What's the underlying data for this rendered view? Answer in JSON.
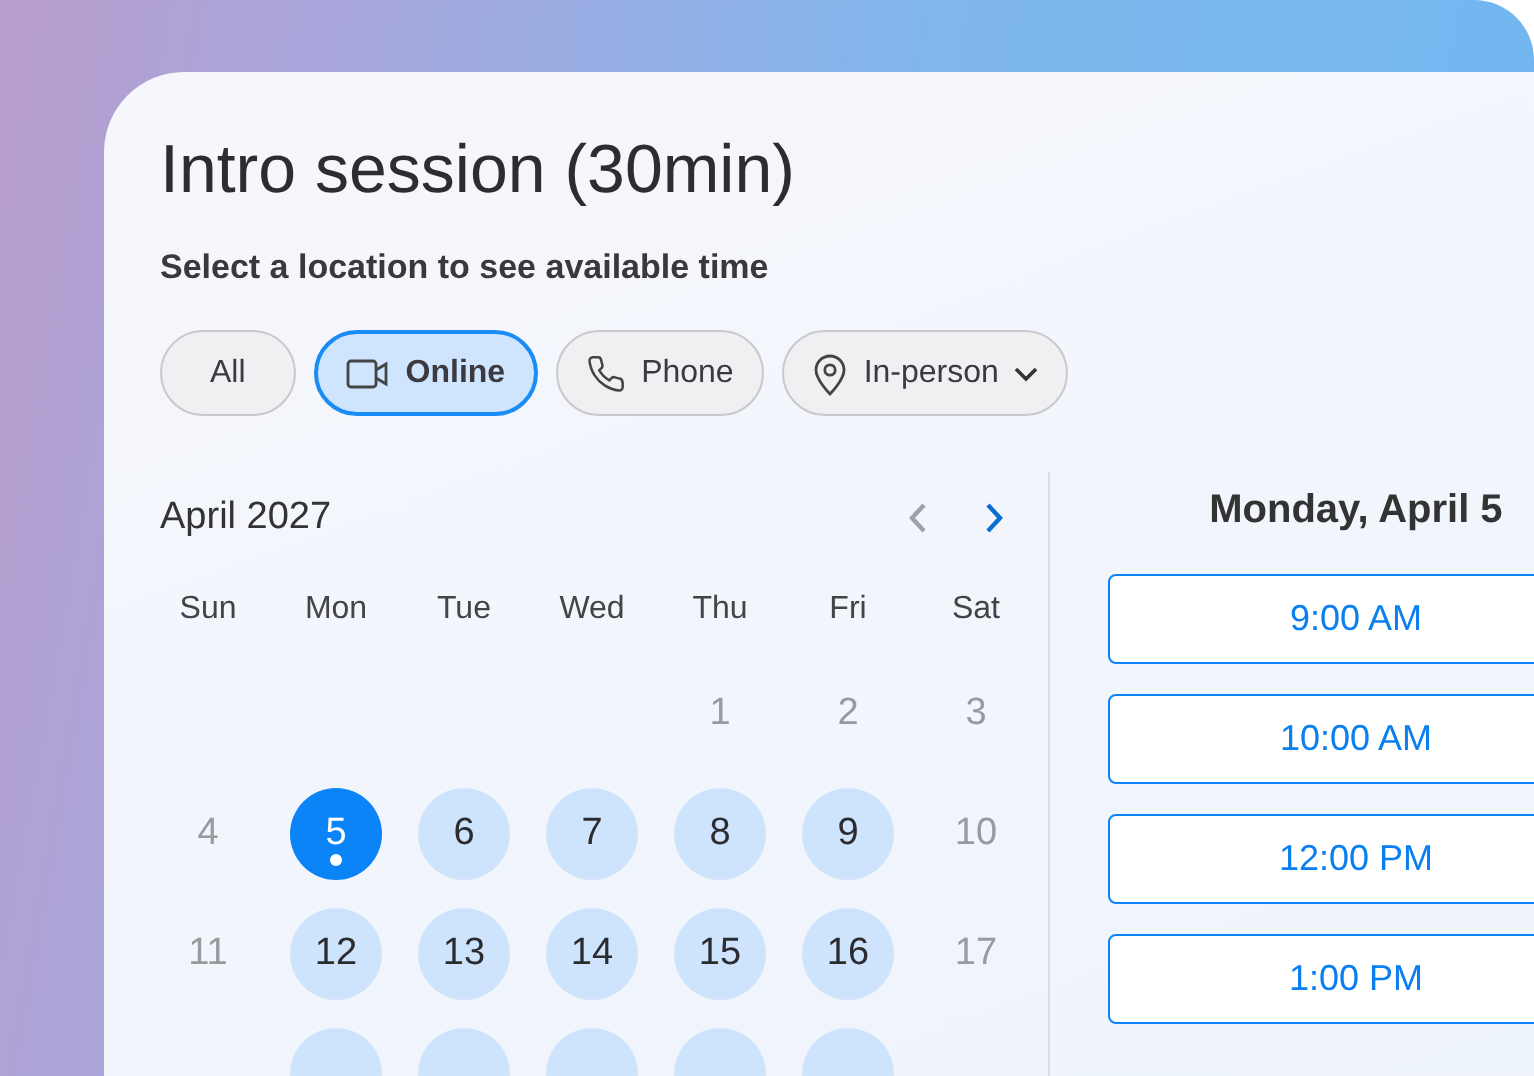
{
  "title": "Intro session (30min)",
  "subtitle": "Select a location to see available time",
  "filters": [
    {
      "label": "All",
      "kind": "none",
      "selected": false,
      "has_menu": false
    },
    {
      "label": "Online",
      "kind": "video",
      "selected": true,
      "has_menu": false
    },
    {
      "label": "Phone",
      "kind": "phone",
      "selected": false,
      "has_menu": false
    },
    {
      "label": "In-person",
      "kind": "pin",
      "selected": false,
      "has_menu": true
    }
  ],
  "calendar": {
    "month": "April 2027",
    "prev_disabled": true,
    "next_disabled": false,
    "weekdays": [
      "Sun",
      "Mon",
      "Tue",
      "Wed",
      "Thu",
      "Fri",
      "Sat"
    ],
    "weeks": [
      [
        {
          "day": "1",
          "available": false,
          "selected": false,
          "marked": false
        },
        {
          "day": "2",
          "available": false,
          "selected": false,
          "marked": false
        },
        {
          "day": "3",
          "available": false,
          "selected": false,
          "marked": false
        }
      ],
      [
        {
          "day": "4",
          "available": false,
          "selected": false,
          "marked": false
        },
        {
          "day": "5",
          "available": true,
          "selected": true,
          "marked": true
        },
        {
          "day": "6",
          "available": true,
          "selected": false,
          "marked": false
        },
        {
          "day": "7",
          "available": true,
          "selected": false,
          "marked": false
        },
        {
          "day": "8",
          "available": true,
          "selected": false,
          "marked": false
        },
        {
          "day": "9",
          "available": true,
          "selected": false,
          "marked": false
        },
        {
          "day": "10",
          "available": false,
          "selected": false,
          "marked": false
        }
      ],
      [
        {
          "day": "11",
          "available": false,
          "selected": false,
          "marked": false
        },
        {
          "day": "12",
          "available": true,
          "selected": false,
          "marked": false
        },
        {
          "day": "13",
          "available": true,
          "selected": false,
          "marked": false
        },
        {
          "day": "14",
          "available": true,
          "selected": false,
          "marked": false
        },
        {
          "day": "15",
          "available": true,
          "selected": false,
          "marked": false
        },
        {
          "day": "16",
          "available": true,
          "selected": false,
          "marked": false
        },
        {
          "day": "17",
          "available": false,
          "selected": false,
          "marked": false
        }
      ],
      [
        {
          "available": true,
          "selected": false
        },
        {
          "available": true,
          "selected": false
        },
        {
          "available": true,
          "selected": false
        },
        {
          "available": true,
          "selected": false
        },
        {
          "available": true,
          "selected": false
        }
      ]
    ]
  },
  "schedule": {
    "date": "Monday, April 5",
    "slots": [
      "9:00 AM",
      "10:00 AM",
      "12:00 PM",
      "1:00 PM"
    ]
  }
}
